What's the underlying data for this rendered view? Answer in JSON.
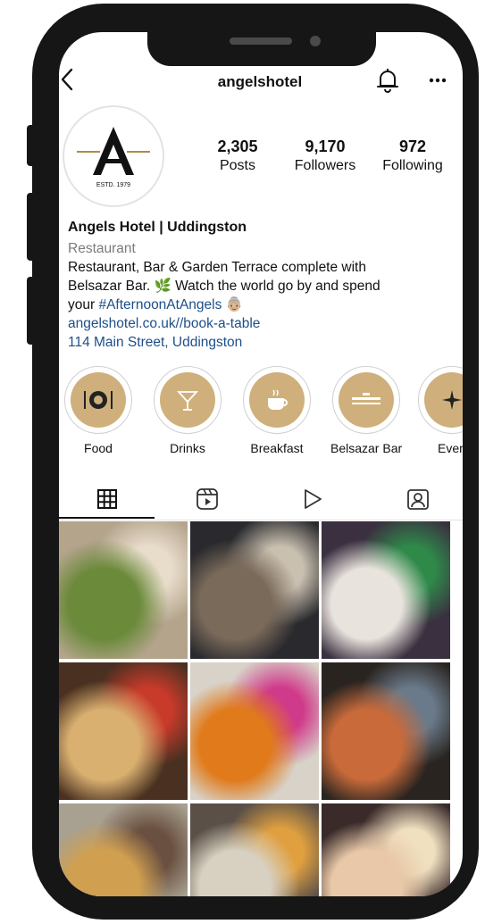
{
  "profile": {
    "username": "angelshotel",
    "logo_text": "ESTD. 1979",
    "stats": [
      {
        "value": "2,305",
        "label": "Posts"
      },
      {
        "value": "9,170",
        "label": "Followers"
      },
      {
        "value": "972",
        "label": "Following"
      }
    ],
    "name": "Angels Hotel | Uddingston",
    "category": "Restaurant",
    "bio_line1": "Restaurant, Bar & Garden Terrace complete with",
    "bio_line2": "Belsazar Bar. 🌿 Watch the world go by and spend",
    "bio_line3_prefix": "your ",
    "bio_hashtag": "#AfternoonAtAngels",
    "bio_emoji": "👵🏼",
    "link": "angelshotel.co.uk//book-a-table",
    "address": "114 Main Street, Uddingston"
  },
  "highlights": [
    {
      "label": "Food",
      "icon": "plate-icon"
    },
    {
      "label": "Drinks",
      "icon": "cocktail-icon"
    },
    {
      "label": "Breakfast",
      "icon": "coffee-cup-icon"
    },
    {
      "label": "Belsazar Bar",
      "icon": "bar-icon"
    },
    {
      "label": "Even",
      "icon": "sparkle-icon"
    }
  ],
  "tabs": [
    {
      "name": "grid-icon",
      "active": true
    },
    {
      "name": "reels-icon",
      "active": false
    },
    {
      "name": "play-icon",
      "active": false
    },
    {
      "name": "tagged-icon",
      "active": false
    }
  ],
  "icons": {
    "back": "back-arrow-icon",
    "notifications": "bell-icon",
    "more": "more-options-icon"
  },
  "glyphs": {
    "back": "<",
    "more": "···"
  },
  "colors": {
    "highlight_gold": "#cfb07c",
    "link_blue": "#1d4f8a",
    "phone_frame": "#161616"
  },
  "posts": [
    {
      "subject": "pasta with rocket salad",
      "colors": [
        "#b4a48c",
        "#6b8a3a",
        "#e8dccb"
      ]
    },
    {
      "subject": "couple at dining table",
      "colors": [
        "#2a2a2e",
        "#7a6a5a",
        "#c9c0b0"
      ]
    },
    {
      "subject": "couple selfie",
      "colors": [
        "#3a3040",
        "#e9e3dd",
        "#2f8a4a"
      ]
    },
    {
      "subject": "dessert with strawberry",
      "colors": [
        "#4a3020",
        "#d9b070",
        "#c83a2a"
      ]
    },
    {
      "subject": "two women posing",
      "colors": [
        "#d8d2c8",
        "#e07a1a",
        "#d03a8a"
      ]
    },
    {
      "subject": "two men at bar",
      "colors": [
        "#2a2420",
        "#c86a3a",
        "#6a7a8a"
      ]
    },
    {
      "subject": "food platter with drinks",
      "colors": [
        "#a8a090",
        "#d0a050",
        "#6a5040"
      ]
    },
    {
      "subject": "pasta dishes",
      "colors": [
        "#5a5048",
        "#d8d0c0",
        "#e0a040"
      ]
    },
    {
      "subject": "two blonde women",
      "colors": [
        "#3a2a2a",
        "#e8c8a8",
        "#f0e0c0"
      ]
    }
  ]
}
